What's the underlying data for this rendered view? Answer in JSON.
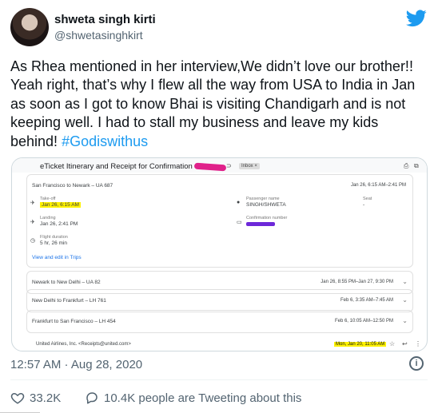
{
  "tweet": {
    "name": "shweta singh kirti",
    "handle": "@shwetasinghkirt",
    "text": "As Rhea mentioned in her interview,We didn’t love our brother!! Yeah right, that’s why I flew all the way from USA to India in Jan as soon as I got to know Bhai is visiting Chandigarh and is not keeping well. I had to stall my business and leave my kids behind! ",
    "hashtag": "#Godiswithus",
    "timestamp": "12:57 AM · Aug 28, 2020",
    "likes": "33.2K",
    "replies_text": "10.4K people are Tweeting about this"
  },
  "email": {
    "subject": "eTicket Itinerary and Receipt for Confirmation",
    "inbox_chip": "Inbox ×",
    "route_main": "San Francisco to Newark – UA 687",
    "route_main_time": "Jan 26, 6:15 AM–2:41 PM",
    "takeoff_label": "Take-off",
    "takeoff_value": "Jan 26, 6:15 AM",
    "landing_label": "Landing",
    "landing_value": "Jan 26, 2:41 PM",
    "duration_label": "Flight duration",
    "duration_value": "5 hr, 26 min",
    "passenger_label": "Passenger name",
    "passenger_value": "SINGH/SHWETA",
    "confirmation_label": "Confirmation number",
    "seat_label": "Seat",
    "seat_value": "-",
    "view_link": "View and edit in Trips",
    "segments": [
      {
        "route": "Newark to New Delhi – UA 82",
        "time": "Jan 26, 8:55 PM–Jan 27, 9:30 PM"
      },
      {
        "route": "New Delhi to Frankfurt – LH 761",
        "time": "Feb 6, 3:35 AM–7:45 AM"
      },
      {
        "route": "Frankfurt to San Francisco – LH 454",
        "time": "Feb 6, 10:05 AM–12:50 PM"
      }
    ],
    "sender": "United Airlines, Inc. <Receipts@united.com>",
    "sender_date": "Mon, Jan 20, 11:05 AM"
  },
  "colors": {
    "accent": "#1d9bf0",
    "highlight": "#fff200",
    "redact": "#e0218a"
  }
}
